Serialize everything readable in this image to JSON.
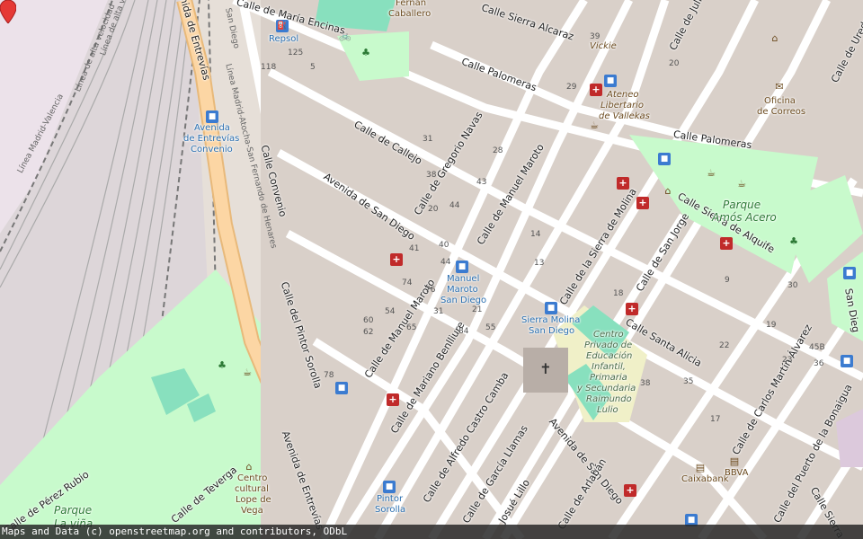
{
  "streets": {
    "maria_encinas": "Calle de María Encinas",
    "sierra_alcaraz": "Calle Sierra Alcaraz",
    "palomeras_1": "Calle Palomeras",
    "palomeras_2": "Calle Palomeras",
    "callejo": "Calle de Callejo",
    "gregorio_navas": "Calle de Gregorio Navas",
    "manuel_maroto_1": "Calle de Manuel Maroto",
    "manuel_maroto_2": "Calle de Manuel Maroto",
    "avenida_san_diego_1": "Avenida de San Diego",
    "avenida_san_diego_2": "Avenida de San Diego",
    "sierra_molina": "Calle de la Sierra de Molina",
    "san_jorge": "Calle de San Jorge",
    "sierra_alquife": "Calle Sierra de Alquife",
    "santa_alicia": "Calle Santa Alicia",
    "carlos_martin_alvarez": "Calle de Carlos Martín Álvarez",
    "puerto_bonaigua": "Calle del Puerto de la Bonaigua",
    "mariano_benlliure": "Calle de Mariano Benlliure",
    "alfredo_castro_camba": "Calle de Alfredo Castro Camba",
    "garcia_llamas": "Calle de García Llamas",
    "josue_lillo": "Josué Lillo",
    "arlaban": "Calle de Arlabán",
    "convenio": "Calle Convenio",
    "pintor_sorolla": "Calle del Pintor Sorolla",
    "entrevias_1": "nida de Entrevías",
    "entrevias_2": "Avenida de Entrevías",
    "teverga": "Calle de Teverga",
    "perez_rubio": "Calle de Pérez Rubio",
    "julio": "Calle de Juli",
    "ureda": "Calle de Ureda",
    "sierra_2": "Calle Sierra",
    "san_diego_right": "San Dieg"
  },
  "railways": {
    "line_1": "Línea Madrid-Valencia",
    "line_2": "Línea de alta velocidad",
    "line_3": "Línea de alta veloc",
    "line_4": "Línea Madrid-Atocha-San Fernando de Henares",
    "line_5": "San Diego"
  },
  "pois": {
    "repsol": "Repsol",
    "fernan_caballero_1": "Fernán",
    "fernan_caballero_2": "Caballero",
    "vickie": "Vickie",
    "ateneo_1": "Ateneo",
    "ateneo_2": "Libertario",
    "ateneo_3": "de Vallekas",
    "correos_1": "Oficina",
    "correos_2": "de Correos",
    "parque_amos_1": "Parque",
    "parque_amos_2": "Amós Acero",
    "parque_vina_1": "Parque",
    "parque_vina_2": "La viña",
    "centro_cultural_1": "Centro",
    "centro_cultural_2": "cultural",
    "centro_cultural_3": "Lope de",
    "centro_cultural_4": "Vega",
    "school_1": "Centro",
    "school_2": "Privado de",
    "school_3": "Educación",
    "school_4": "Infantil,",
    "school_5": "Primaria",
    "school_6": "y Secundaria",
    "school_7": "Raimundo",
    "school_8": "Lulio",
    "caixabank": "Caixabank",
    "bbva": "BBVA"
  },
  "stops": {
    "entrevias_convenio_1": "Avenida",
    "entrevias_convenio_2": "de Entrevías",
    "entrevias_convenio_3": "Convenio",
    "maroto_sandiego_1": "Manuel",
    "maroto_sandiego_2": "Maroto",
    "maroto_sandiego_3": "San Diego",
    "sierra_molina_1": "Sierra Molina",
    "sierra_molina_2": "San Diego",
    "pintor_sorolla_1": "Pintor",
    "pintor_sorolla_2": "Sorolla"
  },
  "house_numbers": [
    "125",
    "5",
    "118",
    "31",
    "38",
    "43",
    "29",
    "39",
    "41",
    "20",
    "44",
    "40",
    "44",
    "76",
    "54",
    "74",
    "60",
    "62",
    "65",
    "78",
    "31",
    "84",
    "55",
    "21",
    "28",
    "13",
    "14",
    "18",
    "38",
    "35",
    "22",
    "9",
    "30",
    "23",
    "19",
    "20",
    "45B",
    "36",
    "17"
  ],
  "icons": {
    "pin": "map-marker-icon",
    "fuel": "fuel-station-icon",
    "bicycle": "bicycle-rental-icon",
    "pharmacy": "pharmacy-icon",
    "bus": "bus-stop-icon",
    "church": "church-icon",
    "post": "post-office-icon",
    "playground": "playground-icon",
    "bank": "bank-icon",
    "community": "community-centre-icon"
  },
  "colors": {
    "background": "#e6dfd8",
    "block": "#d9d0c9",
    "road": "#ffffff",
    "primary_road": "#fcd6a4",
    "park": "#c8facc",
    "pitch": "#88e0be",
    "rail": "#999999",
    "marker": "#e53935"
  },
  "attribution": "Maps and Data (c) openstreetmap.org and contributors, ODbL"
}
